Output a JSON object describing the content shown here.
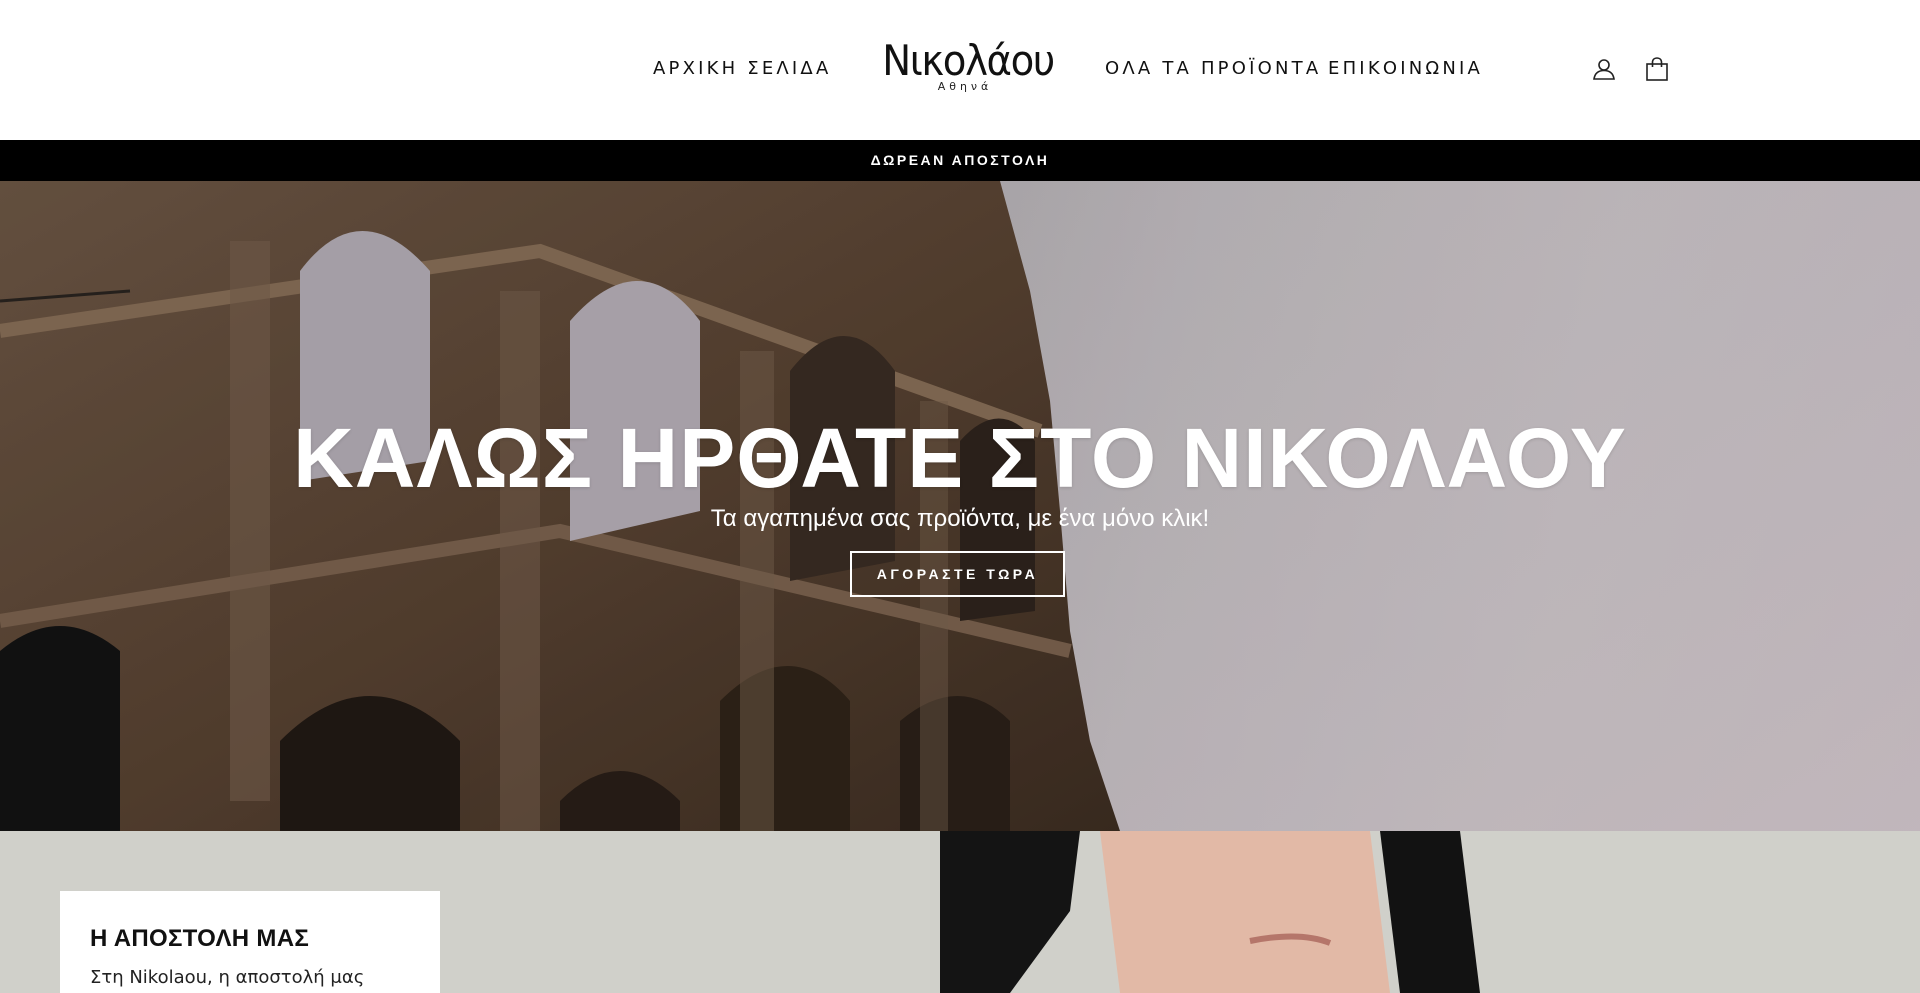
{
  "header": {
    "nav_left": [
      {
        "label": "ΑΡΧΙΚΗ ΣΕΛΙΔΑ"
      }
    ],
    "logo": {
      "name": "Νικολάου",
      "sub": "Αθηνά"
    },
    "nav_right": [
      {
        "label": "ΟΛΑ ΤΑ ΠΡΟΪΟΝΤΑ"
      },
      {
        "label": "ΕΠΙΚΟΙΝΩΝΙΑ"
      }
    ],
    "icons": {
      "account": "user-icon",
      "cart": "shopping-bag-icon"
    }
  },
  "announcement": {
    "text": "ΔΩΡΕΑΝ ΑΠΟΣΤΟΛΗ"
  },
  "hero": {
    "title": "ΚΑΛΩΣ ΗΡΘΑΤΕ ΣΤΟ ΝΙΚΟΛΑΟΥ",
    "subtitle": "Τα αγαπημένα σας προϊόντα, με ένα μόνο κλικ!",
    "button_label": "ΑΓΟΡΑΣΤΕ ΤΩΡΑ"
  },
  "mission": {
    "title": "Η ΑΠΟΣΤΟΛΗ ΜΑΣ",
    "text": "Στη Nikolaou, η αποστολή μας"
  },
  "colors": {
    "announcement_bg": "#000000",
    "text": "#111111",
    "hero_text": "#ffffff"
  }
}
